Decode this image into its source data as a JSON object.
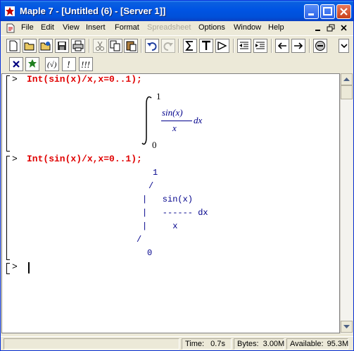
{
  "window": {
    "title": "Maple 7  - [Untitled (6) - [Server 1]]"
  },
  "menu": [
    "File",
    "Edit",
    "View",
    "Insert",
    "Format",
    "Spreadsheet",
    "Options",
    "Window",
    "Help"
  ],
  "worksheet": {
    "groups": [
      {
        "prompt": ">",
        "command": "Int(sin(x)/x,x=0..1);",
        "output": {
          "upper": "1",
          "lower": "0",
          "numerator": "sin(x)",
          "denominator": "x",
          "differential": "dx"
        }
      },
      {
        "prompt": ">",
        "command": "Int(sin(x)/x,x=0..1);",
        "output_lines": [
          "1",
          "/",
          "|   sin(x)",
          "|   ------ dx",
          "|     x",
          "/",
          "0"
        ]
      }
    ],
    "empty_prompt": ">"
  },
  "status": {
    "time_label": "Time:",
    "time_value": "0.7s",
    "bytes_label": "Bytes:",
    "bytes_value": "3.00M",
    "available_label": "Available:",
    "available_value": "95.3M"
  },
  "colors": {
    "command": "#e00000",
    "output": "#00008b",
    "titlebar": "#0054e3"
  }
}
